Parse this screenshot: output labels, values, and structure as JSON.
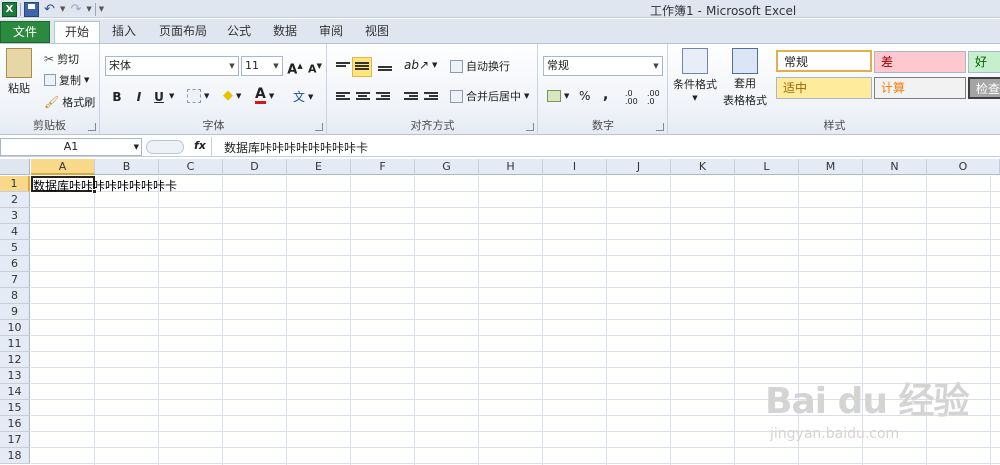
{
  "window": {
    "doc_name": "工作簿1",
    "separator": "-",
    "app_name": "Microsoft Excel"
  },
  "tabs": {
    "file": "文件",
    "items": [
      "开始",
      "插入",
      "页面布局",
      "公式",
      "数据",
      "审阅",
      "视图"
    ]
  },
  "ribbon": {
    "clipboard": {
      "paste": "粘贴",
      "cut": "剪切",
      "copy": "复制",
      "format_painter": "格式刷",
      "label": "剪贴板"
    },
    "font": {
      "font_name": "宋体",
      "font_size": "11",
      "bold": "B",
      "italic": "I",
      "underline": "U",
      "label": "字体"
    },
    "alignment": {
      "wrap_text": "自动换行",
      "merge_center": "合并后居中",
      "label": "对齐方式"
    },
    "number": {
      "format": "常规",
      "percent": "%",
      "comma": ",",
      "label": "数字"
    },
    "styles": {
      "conditional_format": "条件格式",
      "table_format_1": "套用",
      "table_format_2": "表格格式",
      "normal": "常规",
      "bad": "差",
      "good": "好",
      "neutral": "适中",
      "calculation": "计算",
      "check": "检查",
      "label": "样式"
    }
  },
  "formula_bar": {
    "name_box": "A1",
    "fx": "fx",
    "value": "数据库咔咔咔咔咔咔咔咔卡"
  },
  "sheet": {
    "columns": [
      "A",
      "B",
      "C",
      "D",
      "E",
      "F",
      "G",
      "H",
      "I",
      "J",
      "K",
      "L",
      "M",
      "N",
      "O"
    ],
    "rows": [
      "1",
      "2",
      "3",
      "4",
      "5",
      "6",
      "7",
      "8",
      "9",
      "10",
      "11",
      "12",
      "13",
      "14",
      "15",
      "16",
      "17",
      "18"
    ],
    "a1_value": "数据库咔咔咔咔咔咔咔咔卡"
  },
  "watermark": {
    "brand": "Bai du 经验",
    "url": "jingyan.baidu.com"
  },
  "colors": {
    "file_tab": "#2c8a3e",
    "selection_header": "#f8d98a",
    "style_bad_bg": "#ffc7ce",
    "style_good_bg": "#c6efce",
    "style_neutral_bg": "#ffeb9c"
  }
}
